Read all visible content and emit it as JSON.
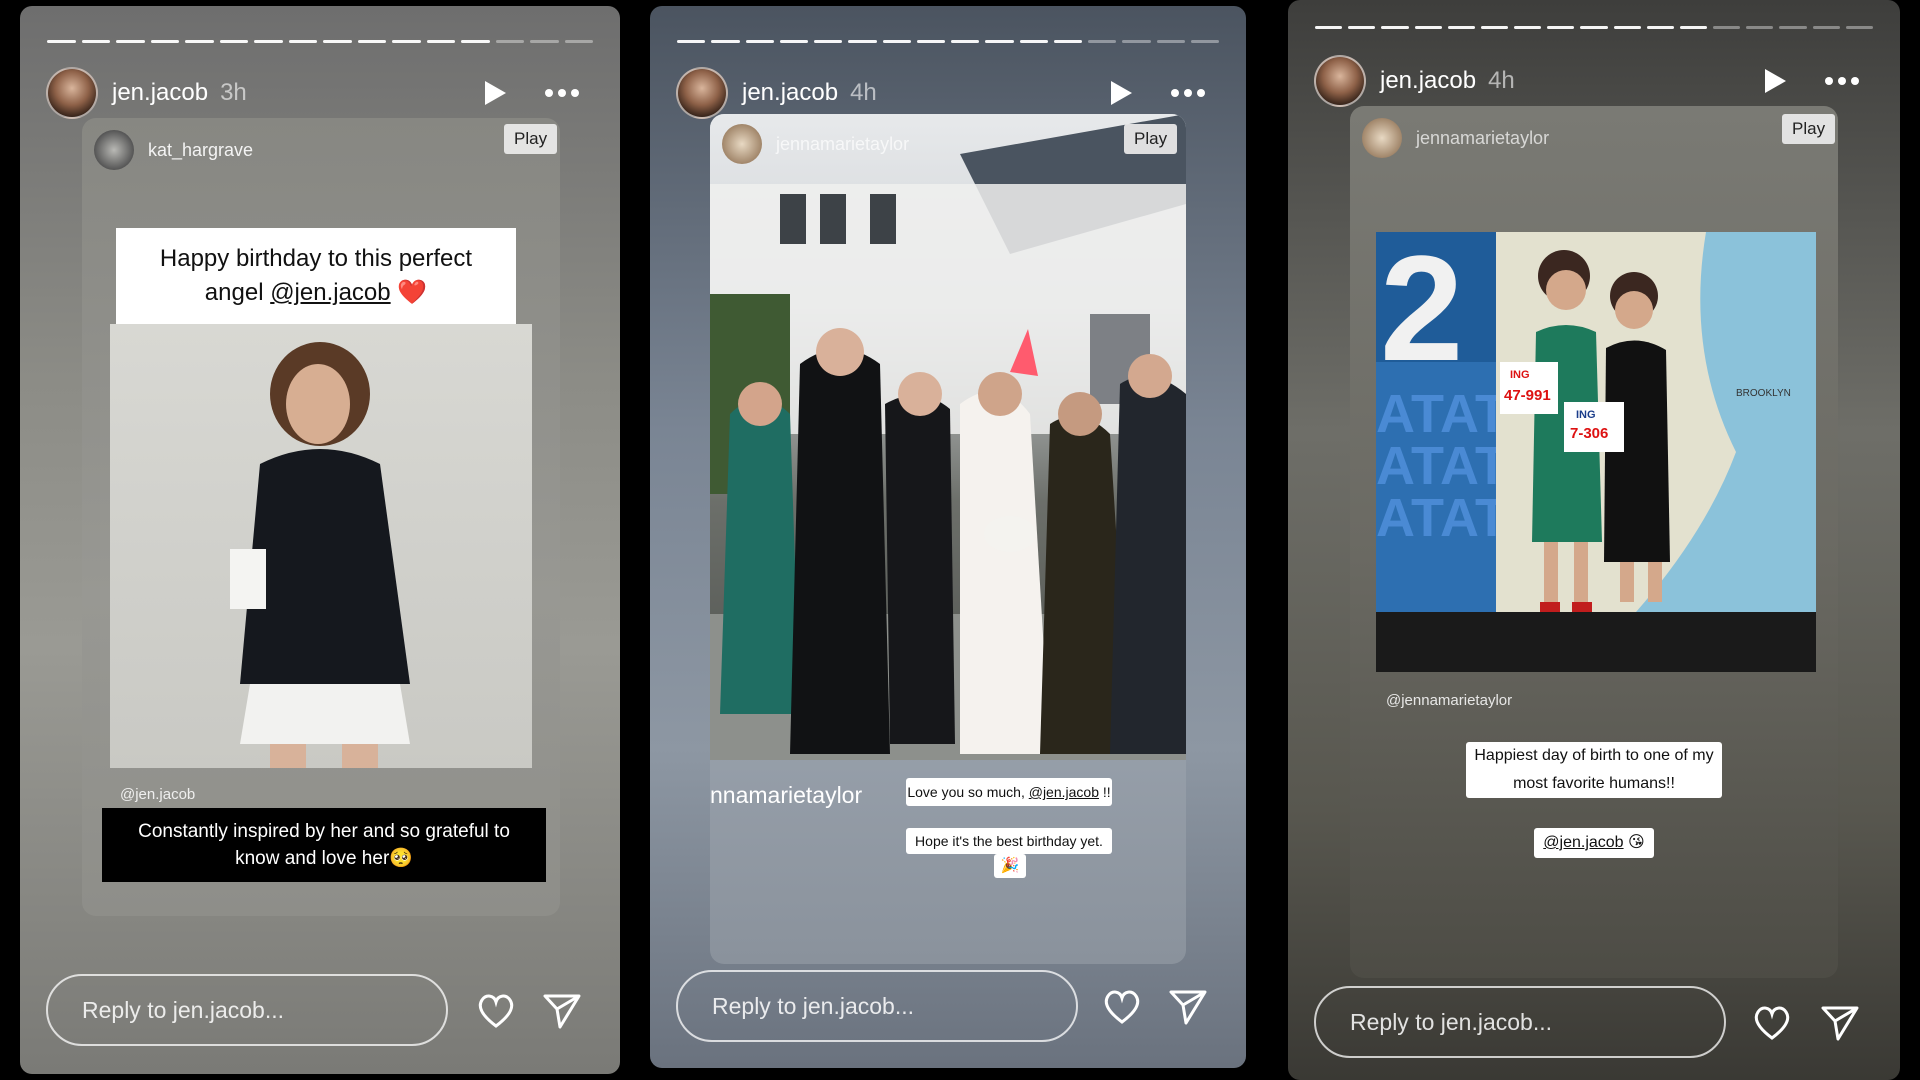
{
  "stories": [
    {
      "username": "jen.jacob",
      "time": "3h",
      "progress": {
        "segments": 16,
        "done": 13
      },
      "card_user": "kat_hargrave",
      "play_label": "Play",
      "caption_top": "Happy birthday to this perfect",
      "caption_top_line2_prefix": "angel ",
      "caption_top_mention": "@jen.jacob",
      "caption_top_emoji": "❤️",
      "photo_tag": "@jen.jacob",
      "caption_bottom": "Constantly inspired by her and so grateful to know and love her🥺",
      "reply_placeholder": "Reply to jen.jacob..."
    },
    {
      "username": "jen.jacob",
      "time": "4h",
      "progress": {
        "segments": 16,
        "done": 12
      },
      "card_user": "jennamarietaylor",
      "play_label": "Play",
      "handle_partial": "nnamarietaylor",
      "sticker1_prefix": "Love you so much, ",
      "sticker1_mention": "@jen.jacob",
      "sticker1_suffix": " !!",
      "sticker2": "Hope it's the best birthday yet.",
      "sticker2_emoji": "🎉",
      "reply_placeholder": "Reply to jen.jacob..."
    },
    {
      "username": "jen.jacob",
      "time": "4h",
      "progress": {
        "segments": 17,
        "done": 12
      },
      "card_user": "jennamarietaylor",
      "play_label": "Play",
      "photo_tag": "@jennamarietaylor",
      "sticker1_line1": "Happiest day of birth to one of my",
      "sticker1_line2": "most favorite humans!!",
      "sticker2_mention": "@jen.jacob",
      "sticker2_emoji": "😘",
      "reply_placeholder": "Reply to jen.jacob..."
    }
  ],
  "photo_text": {
    "bib1": "ING",
    "bib1_num": "47-991",
    "bib2": "ING",
    "bib2_num": "7-306",
    "map_label": "BROOKLYN",
    "big_digit": "2",
    "wall_text": "ATAT"
  },
  "colors": {
    "accent_heart": "#e02b2b",
    "reply_border": "#ffffff"
  },
  "icons": {
    "play": "play-icon",
    "more": "more-icon",
    "heart": "heart-icon",
    "send": "send-icon"
  }
}
